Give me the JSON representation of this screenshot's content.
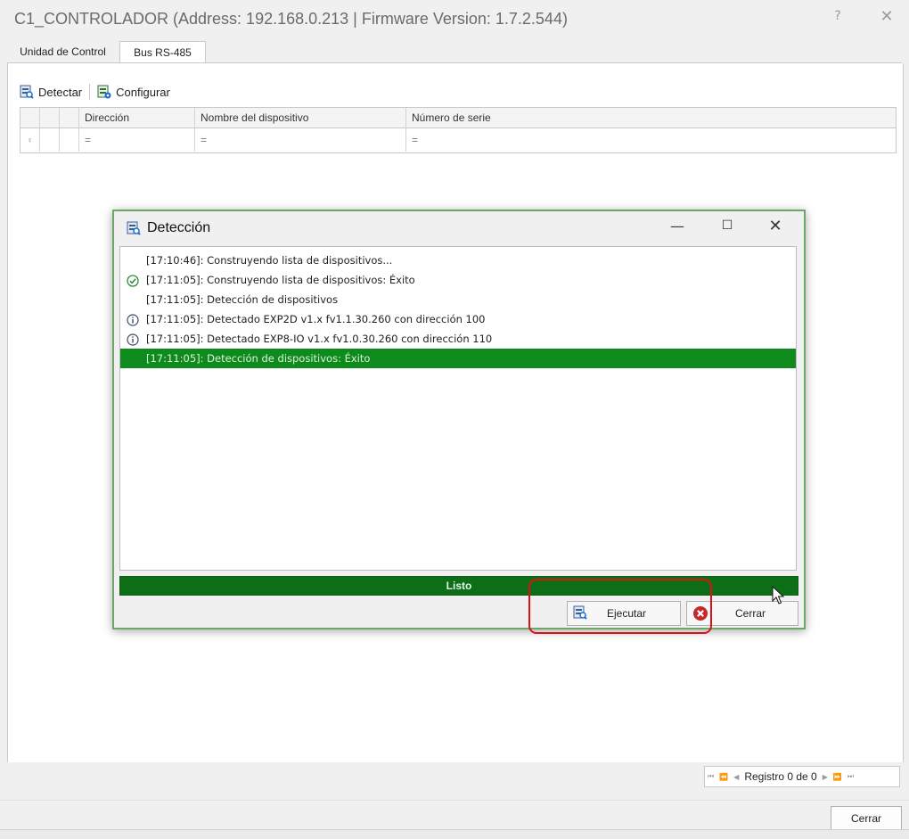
{
  "window": {
    "title": "C1_CONTROLADOR (Address: 192.168.0.213 | Firmware Version: 1.7.2.544)",
    "help_glyph": "?",
    "close_glyph": "✕"
  },
  "tabs": [
    {
      "label": "Unidad de Control",
      "active": false
    },
    {
      "label": "Bus RS-485",
      "active": true
    }
  ],
  "toolbar": {
    "detect_label": "Detectar",
    "configure_label": "Configurar"
  },
  "grid": {
    "columns": [
      "Dirección",
      "Nombre del dispositivo",
      "Número de serie"
    ],
    "filter_row": {
      "marker": "♀",
      "ops": [
        "=",
        "=",
        "="
      ]
    }
  },
  "navigator": {
    "first": "⏮",
    "prev_page": "⏪",
    "prev": "◀",
    "record_text": "Registro 0 de 0",
    "next": "▶",
    "next_page": "⏩",
    "last": "⏭"
  },
  "footer": {
    "close_label": "Cerrar"
  },
  "dialog": {
    "title": "Detección",
    "min_glyph": "—",
    "max_glyph": "☐",
    "close_glyph": "✕",
    "log": [
      {
        "icon": "none",
        "text": "[17:10:46]: Construyendo lista de dispositivos..."
      },
      {
        "icon": "check",
        "text": "[17:11:05]: Construyendo lista de dispositivos: Éxito"
      },
      {
        "icon": "none",
        "text": "[17:11:05]: Detección de dispositivos"
      },
      {
        "icon": "info",
        "text": "[17:11:05]: Detectado EXP2D v1.x fv1.1.30.260 con dirección 100"
      },
      {
        "icon": "info",
        "text": "[17:11:05]: Detectado EXP8-IO v1.x fv1.0.30.260 con dirección 110"
      },
      {
        "icon": "none",
        "text": "[17:11:05]: Detección de dispositivos: Éxito",
        "selected": true
      }
    ],
    "status_text": "Listo",
    "execute_label": "Ejecutar",
    "close_label": "Cerrar"
  },
  "colors": {
    "accent_green": "#0f8a1c",
    "progress_green": "#0c6e17",
    "highlight_red": "#dd1111",
    "close_red": "#c62828"
  }
}
